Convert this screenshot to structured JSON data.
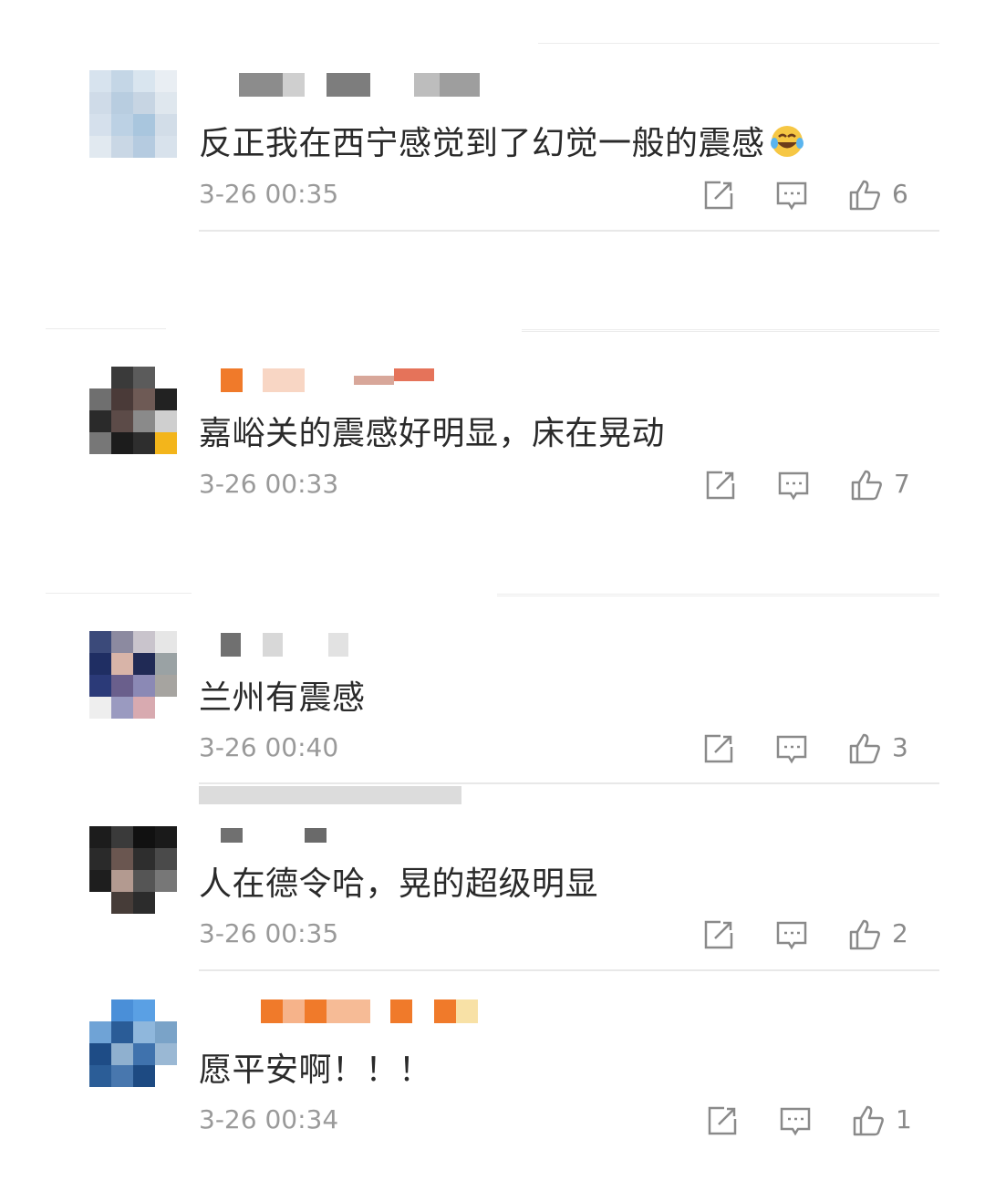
{
  "comments": [
    {
      "text": "反正我在西宁感觉到了幻觉一般的震感",
      "emoji": "laughing-tears-emoji",
      "time": "3-26 00:35",
      "likes": "6"
    },
    {
      "text": "嘉峪关的震感好明显，床在晃动",
      "time": "3-26 00:33",
      "likes": "7"
    },
    {
      "text": "兰州有震感",
      "time": "3-26 00:40",
      "likes": "3"
    },
    {
      "text": "人在德令哈，晃的超级明显",
      "time": "3-26 00:35",
      "likes": "2"
    },
    {
      "text": "愿平安啊！！！",
      "time": "3-26 00:34",
      "likes": "1"
    }
  ],
  "icons": {
    "share": "share-icon",
    "reply": "reply-icon",
    "like": "thumbs-up-icon"
  },
  "colors": {
    "text": "#2a2a2a",
    "meta": "#9a9a9a",
    "divider": "#e8e8e8",
    "username_mosaic": "#f07a2a"
  }
}
